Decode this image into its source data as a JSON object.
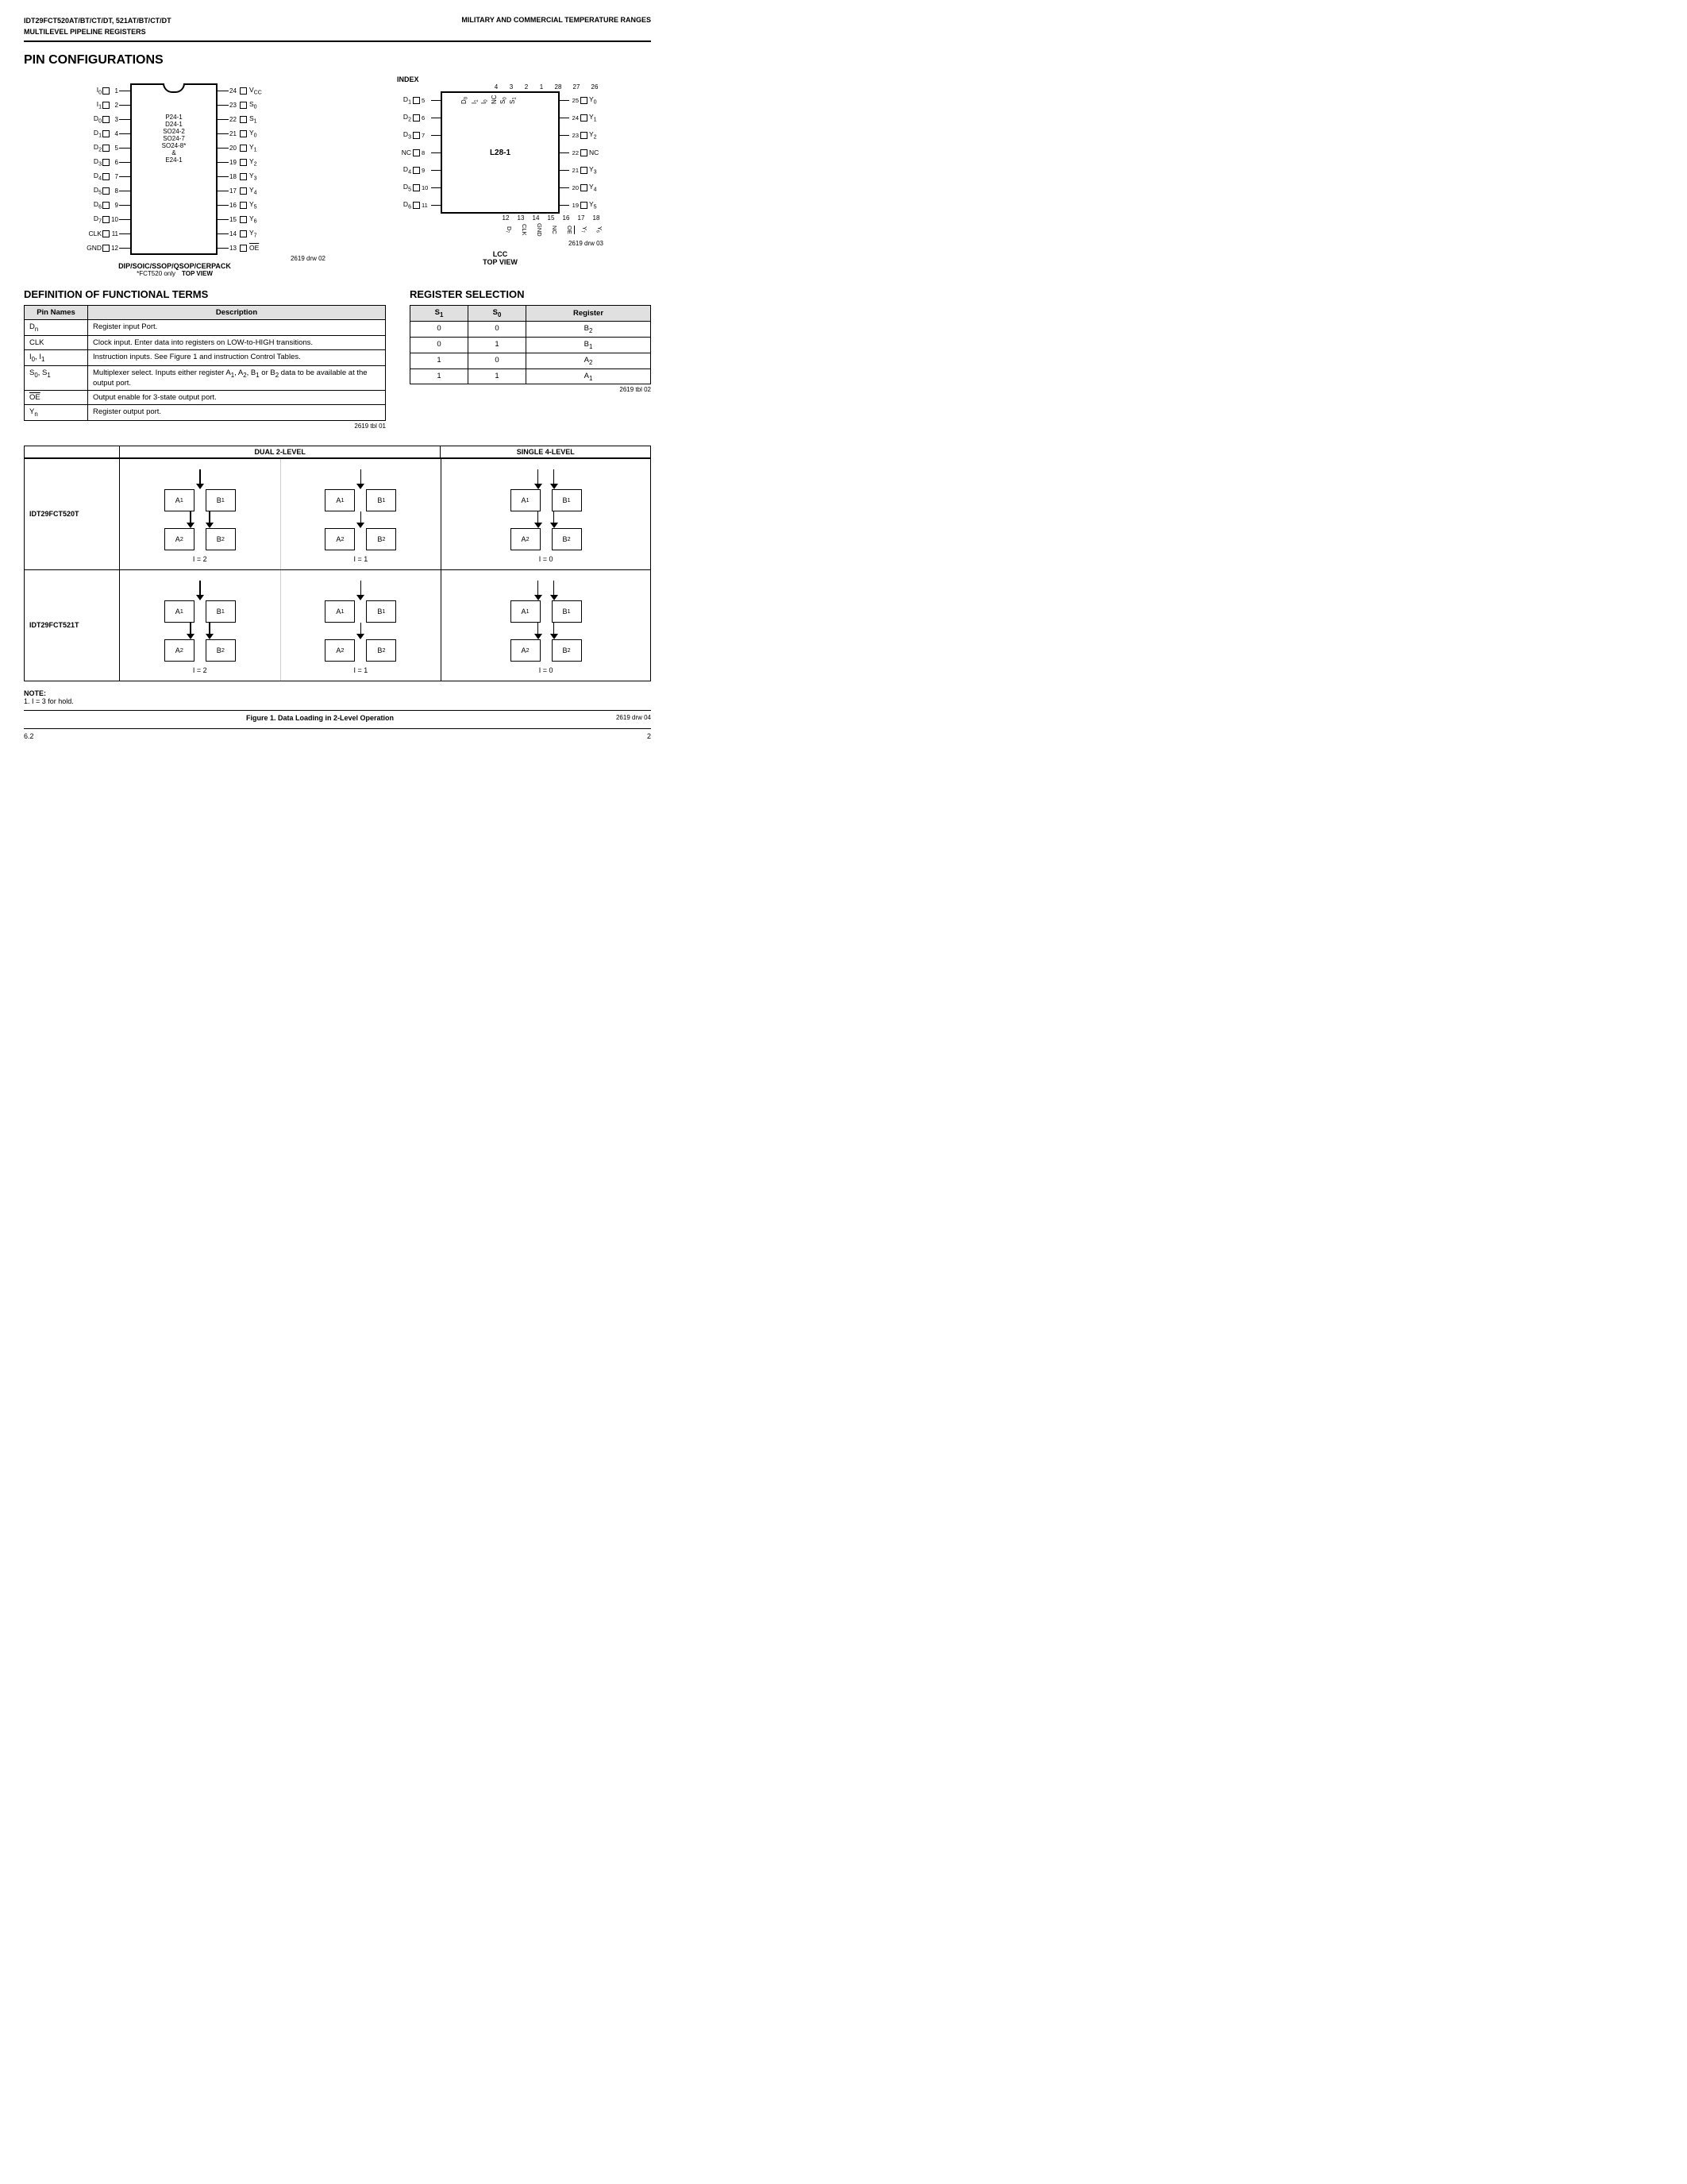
{
  "header": {
    "left": "IDT29FCT520AT/BT/CT/DT, 521AT/BT/CT/DT\nMULTILEVEL PIPELINE REGISTERS",
    "right": "MILITARY AND COMMERCIAL TEMPERATURE RANGES"
  },
  "pin_config": {
    "title": "PIN CONFIGURATIONS",
    "dip_label": "DIP/SOIC/SSOP/QSOP/CERPACK",
    "dip_sublabel": "TOP VIEW",
    "fct_note": "*FCT520 only",
    "lcc_label": "LCC",
    "lcc_sublabel": "TOP VIEW",
    "dip_drw": "2619 drw 02",
    "lcc_drw": "2619 drw 03",
    "left_pins": [
      {
        "num": "1",
        "label": "I₀"
      },
      {
        "num": "2",
        "label": "I₁"
      },
      {
        "num": "3",
        "label": "D₀"
      },
      {
        "num": "4",
        "label": "D₁"
      },
      {
        "num": "5",
        "label": "D₂"
      },
      {
        "num": "6",
        "label": "D₃"
      },
      {
        "num": "7",
        "label": "D₄"
      },
      {
        "num": "8",
        "label": "D₅"
      },
      {
        "num": "9",
        "label": "D₆"
      },
      {
        "num": "10",
        "label": "D₇"
      },
      {
        "num": "11",
        "label": "CLK"
      },
      {
        "num": "12",
        "label": "GND"
      }
    ],
    "right_pins": [
      {
        "num": "24",
        "label": "V_CC"
      },
      {
        "num": "23",
        "label": "S₀"
      },
      {
        "num": "22",
        "label": "S₁"
      },
      {
        "num": "21",
        "label": "Y₀"
      },
      {
        "num": "20",
        "label": "Y₁"
      },
      {
        "num": "19",
        "label": "Y₂"
      },
      {
        "num": "18",
        "label": "Y₃"
      },
      {
        "num": "17",
        "label": "Y₄"
      },
      {
        "num": "16",
        "label": "Y₅"
      },
      {
        "num": "15",
        "label": "Y₆"
      },
      {
        "num": "14",
        "label": "Y₇"
      },
      {
        "num": "13",
        "label": "OE"
      }
    ],
    "center_labels": [
      "P24-1",
      "D24-1",
      "SO24-2",
      "SO24-7",
      "SO24-8*",
      "&",
      "E24-1"
    ]
  },
  "func_terms": {
    "title": "DEFINITION OF FUNCTIONAL TERMS",
    "headers": [
      "Pin Names",
      "Description"
    ],
    "rows": [
      {
        "pin": "Dn",
        "desc": "Register input Port."
      },
      {
        "pin": "CLK",
        "desc": "Clock input. Enter data into registers on LOW-to-HIGH transitions."
      },
      {
        "pin": "I₀, I₁",
        "desc": "Instruction inputs. See Figure 1 and instruction Control Tables."
      },
      {
        "pin": "S₀, S₁",
        "desc": "Multiplexer select. Inputs either register A₁, A₂, B₁ or B₂ data to be available at the output port."
      },
      {
        "pin": "OE",
        "desc": "Output enable for 3-state output port."
      },
      {
        "pin": "Yn",
        "desc": "Register output port."
      }
    ],
    "note": "2619 tbl 01"
  },
  "reg_selection": {
    "title": "REGISTER SELECTION",
    "headers": [
      "S₁",
      "S₀",
      "Register"
    ],
    "rows": [
      {
        "s1": "0",
        "s0": "0",
        "reg": "B₂"
      },
      {
        "s1": "0",
        "s0": "1",
        "reg": "B₁"
      },
      {
        "s1": "1",
        "s0": "0",
        "reg": "A₂"
      },
      {
        "s1": "1",
        "s0": "1",
        "reg": "A₁"
      }
    ],
    "note": "2619 tbl 02"
  },
  "block_diagram": {
    "header_dual": "DUAL 2-LEVEL",
    "header_single": "SINGLE 4-LEVEL",
    "row1_label": "IDT29FCT520T",
    "row2_label": "IDT29FCT521T",
    "cells": {
      "r1c1_label": "I = 2",
      "r1c2_label": "I = 1",
      "r1c3_label": "I = 0",
      "r2c1_label": "I = 2",
      "r2c2_label": "I = 1",
      "r2c3_label": "I = 0"
    },
    "box_labels": {
      "A1": "A₁",
      "B1": "B₁",
      "A2": "A₂",
      "B2": "B₂"
    }
  },
  "note": {
    "title": "NOTE:",
    "text": "1. I = 3 for hold."
  },
  "fig_caption": "Figure 1.  Data Loading in 2-Level Operation",
  "fig_drw": "2619 drw 04",
  "page_numbers": {
    "left": "6.2",
    "right": "2"
  },
  "lcc_index_labels": [
    "D₀",
    "I₁",
    "I₀",
    "NC",
    "S₀",
    "S₁"
  ],
  "lcc_num_top": [
    "4",
    "3",
    "2",
    "1",
    "28",
    "27",
    "26"
  ],
  "lcc_left_pins": [
    {
      "num": "5",
      "label": "D₁"
    },
    {
      "num": "6",
      "label": "D₂"
    },
    {
      "num": "7",
      "label": "D₃"
    },
    {
      "num": "8",
      "label": "NC"
    },
    {
      "num": "9",
      "label": "D₄"
    },
    {
      "num": "10",
      "label": "D₅"
    },
    {
      "num": "11",
      "label": "D₆"
    }
  ],
  "lcc_right_pins": [
    {
      "num": "25",
      "label": "Y₀"
    },
    {
      "num": "24",
      "label": "Y₁"
    },
    {
      "num": "23",
      "label": "Y₂"
    },
    {
      "num": "22",
      "label": "NC"
    },
    {
      "num": "21",
      "label": "Y₃"
    },
    {
      "num": "20",
      "label": "Y₄"
    },
    {
      "num": "19",
      "label": "Y₅"
    }
  ],
  "lcc_center": "L28-1",
  "lcc_bottom_labels": [
    "D₇",
    "CLK",
    "GND",
    "NC",
    "OE",
    "Y₇",
    "Y₆"
  ],
  "lcc_num_bottom": [
    "12",
    "13",
    "14",
    "15",
    "16",
    "17",
    "18"
  ]
}
